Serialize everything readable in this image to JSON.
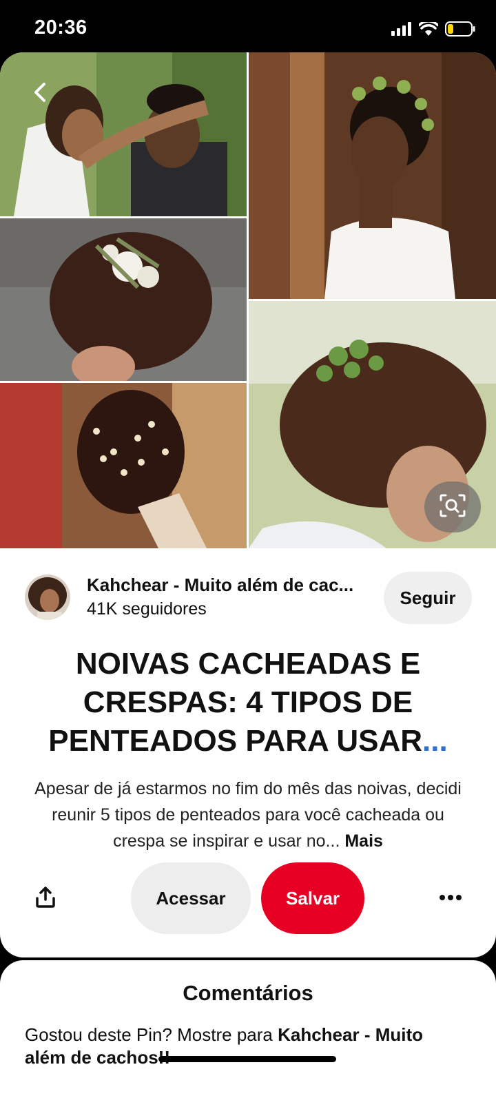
{
  "status_bar": {
    "time": "20:36",
    "battery_level": 0.25
  },
  "pin": {
    "collage_description_icons": [
      "bride-couple-photo",
      "bride-flower-crown-photo",
      "bride-curly-updo-flowers-photo",
      "bride-curly-updo-greenery-photo",
      "bride-curly-updo-pearls-photo"
    ],
    "creator": {
      "name": "Kahchear - Muito além de cac...",
      "followers": "41K seguidores",
      "follow_label": "Seguir"
    },
    "title": "NOIVAS CACHEADAS E CRESPAS: 4 TIPOS DE PENTEADOS PARA USAR",
    "title_ellipsis": "...",
    "description": "Apesar de já estarmos no fim do mês das noivas, decidi reunir 5 tipos de penteados para você cacheada ou crespa se inspirar e usar no...",
    "more_label": "Mais",
    "actions": {
      "visit_label": "Acessar",
      "save_label": "Salvar"
    }
  },
  "comments": {
    "title": "Comentários",
    "prompt_prefix": "Gostou deste Pin? Mostre para ",
    "prompt_creator": "Kahchear - Muito além de cachos!!"
  },
  "colors": {
    "save_red": "#e60023",
    "link_blue": "#2b6fd1",
    "gray_button": "#efefef",
    "battery_yellow": "#ffd60a"
  }
}
